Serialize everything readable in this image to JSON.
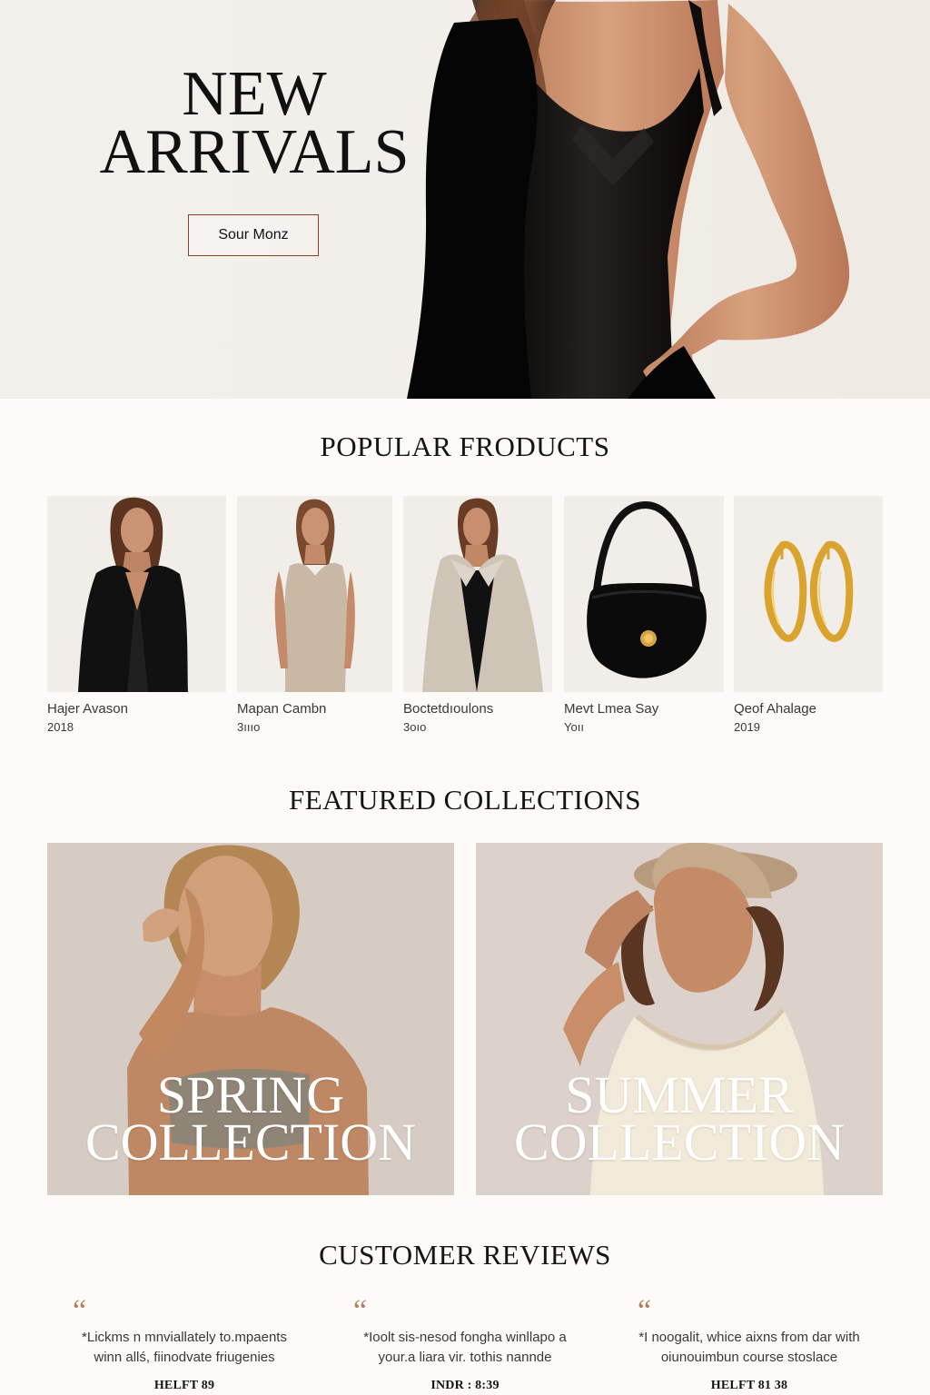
{
  "hero": {
    "title_line_1": "NEW",
    "title_line_2": "ARRIVALS",
    "button_label": "Sour Monz"
  },
  "popular_products": {
    "title": "POPULAR FRODUCTS",
    "items": [
      {
        "name": "Hajer Avason",
        "price": "2018",
        "icon": "black-blazer-image"
      },
      {
        "name": "Mapan Cambn",
        "price": "3ıııo",
        "icon": "beige-dress-image"
      },
      {
        "name": "Boctetdıoulons",
        "price": "3oıo",
        "icon": "beige-coat-image"
      },
      {
        "name": "Mevt Lmea Say",
        "price": "Yoıı",
        "icon": "black-handbag-image"
      },
      {
        "name": "Qeof Ahalage",
        "price": "2019",
        "icon": "gold-hoop-earrings-image"
      }
    ]
  },
  "featured_collections": {
    "title": "FEATURED COLLECTIONS",
    "items": [
      {
        "line_1": "SPRING",
        "line_2": "COLLECTION",
        "icon": "spring-model-image"
      },
      {
        "line_1": "SUMMER",
        "line_2": "COLLECTION",
        "icon": "summer-model-hat-image"
      }
    ]
  },
  "customer_reviews": {
    "title": "CUSTOMER REVIEWS",
    "items": [
      {
        "quote_mark": "“",
        "text_line_1": "*Lickms n mnviallately to.mpaents",
        "text_line_2": "winn allś, fiinodvate friugenies",
        "author": "HELFT 89"
      },
      {
        "quote_mark": "“",
        "text_line_1": "*Ioolt sis-nesod fongha winllapo a",
        "text_line_2": "your.a liara vir. tothis nannde",
        "author": "INDR : 8:39"
      },
      {
        "quote_mark": "“",
        "text_line_1": "*I noogalit, whice aixns from dar with",
        "text_line_2": "oiunouimbun course stoslace",
        "author": "HELFT 81 38"
      }
    ]
  },
  "colors": {
    "page_background": "#fcfbf8",
    "hero_background": "#f2efea",
    "button_border": "#8a3f2c",
    "quote_accent": "#b67d5d"
  }
}
